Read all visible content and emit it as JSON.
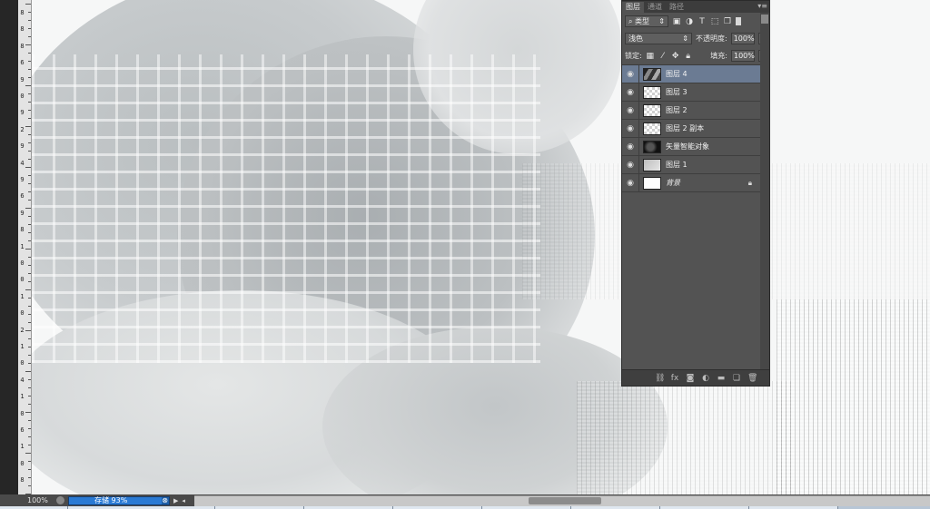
{
  "ruler": {
    "labels": [
      "8",
      "8",
      "8",
      "6",
      "9",
      "0",
      "9",
      "2",
      "9",
      "4",
      "9",
      "6",
      "9",
      "8",
      "1",
      "0",
      "0",
      "1",
      "0",
      "2",
      "1",
      "0",
      "4",
      "1",
      "0",
      "6",
      "1",
      "0",
      "8"
    ]
  },
  "panel": {
    "tabs": [
      "图层",
      "通道",
      "路径"
    ],
    "active_tab": "图层",
    "menu_icon": "panel-menu-icon",
    "filter_label": "类型",
    "blend_mode": "浅色",
    "opacity_label": "不透明度:",
    "opacity_value": "100%",
    "lock_label": "锁定:",
    "fill_label": "填充:",
    "fill_value": "100%",
    "selection_color": "#6b7b93",
    "layers": [
      {
        "name": "图层 4",
        "selected": true,
        "thumb": "photo"
      },
      {
        "name": "图层 3",
        "selected": false,
        "thumb": "checker"
      },
      {
        "name": "图层 2",
        "selected": false,
        "thumb": "checker"
      },
      {
        "name": "图层 2 副本",
        "selected": false,
        "thumb": "checker"
      },
      {
        "name": "矢量智能对象",
        "selected": false,
        "thumb": "dark"
      },
      {
        "name": "图层 1",
        "selected": false,
        "thumb": "gray"
      },
      {
        "name": "背景",
        "selected": false,
        "thumb": "white",
        "locked": true
      }
    ],
    "footer_icons": [
      "link-icon",
      "fx-icon",
      "mask-icon",
      "adjustment-icon",
      "folder-icon",
      "new-layer-icon",
      "trash-icon"
    ]
  },
  "status": {
    "zoom": "100%",
    "progress_text": "存储 93%",
    "progress": 0.93,
    "accent": "#1e5fa8"
  },
  "hscroll": {
    "thumb_start": 0.455,
    "thumb_length": 0.098
  }
}
